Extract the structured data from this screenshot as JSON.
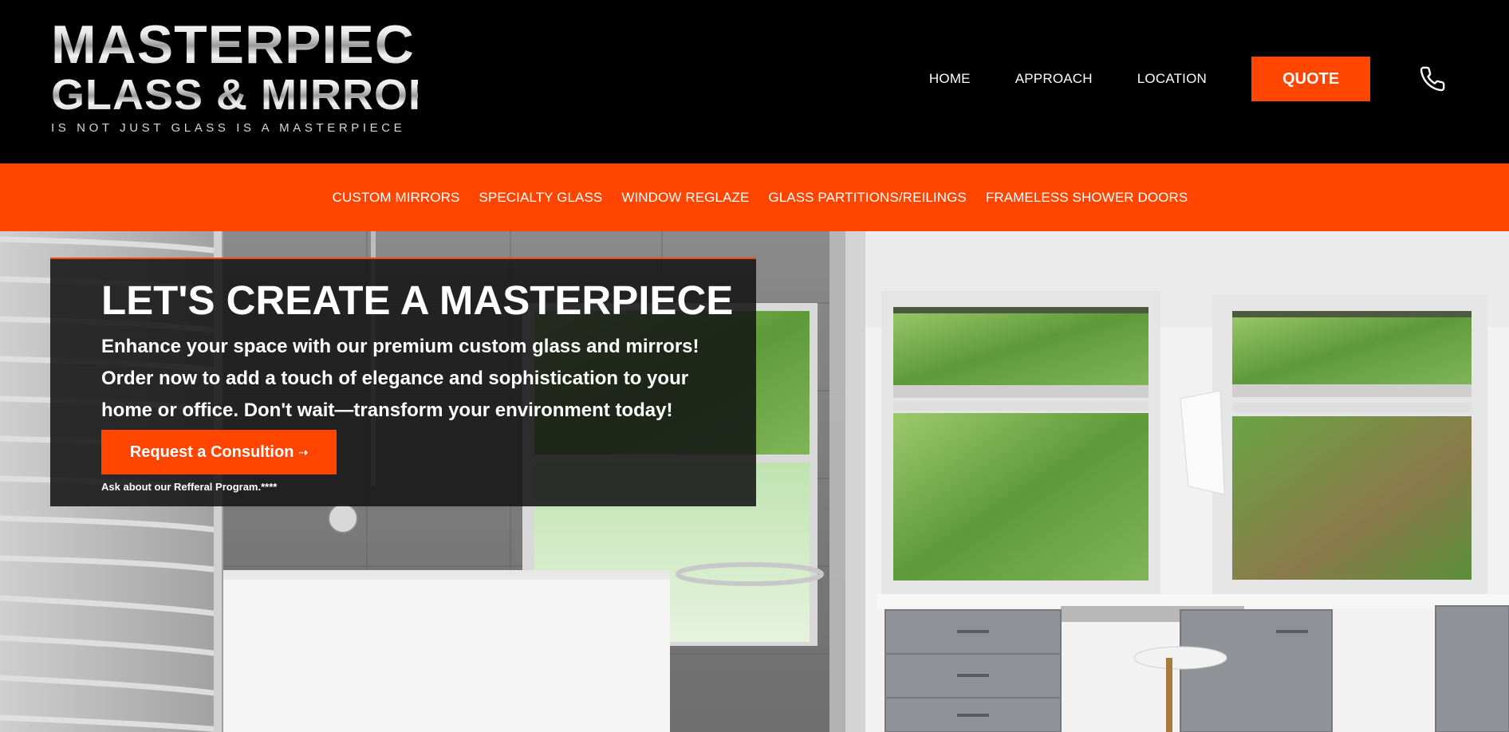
{
  "brand": {
    "line1": "MASTERPIECE",
    "line2": "GLASS & MIRROR",
    "tagline": "IS NOT JUST GLASS IS A MASTERPIECE"
  },
  "topnav": {
    "items": [
      {
        "label": "HOME"
      },
      {
        "label": "APPROACH"
      },
      {
        "label": "LOCATION"
      }
    ],
    "quote_label": "QUOTE",
    "phone_icon": "phone-icon"
  },
  "subnav": {
    "items": [
      {
        "label": "CUSTOM MIRRORS"
      },
      {
        "label": "SPECIALTY GLASS"
      },
      {
        "label": "WINDOW REGLAZE"
      },
      {
        "label": "GLASS PARTITIONS/REILINGS"
      },
      {
        "label": "FRAMELESS SHOWER DOORS"
      }
    ]
  },
  "hero": {
    "title": "LET'S CREATE A MASTERPIECE",
    "text": "Enhance your space with our premium custom glass and mirrors! Order now to add a touch of elegance and sophistication to your home or office. Don't wait—transform your environment today!",
    "cta_label": "Request a Consultion",
    "cta_icon": "arrow-right-icon",
    "note": "Ask about our Refferal Program.****"
  },
  "colors": {
    "accent": "#ff4500",
    "header_bg": "#000000",
    "card_bg": "#141414"
  }
}
